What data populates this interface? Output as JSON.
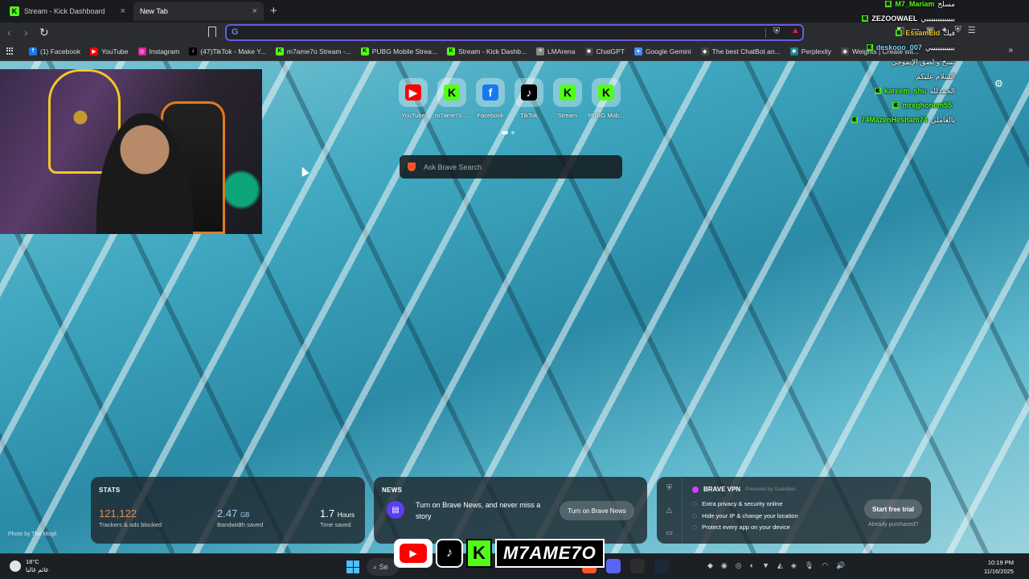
{
  "tabs": [
    {
      "label": "Stream - Kick Dashboard",
      "favicon": "K"
    },
    {
      "label": "New Tab"
    }
  ],
  "bookmarks": [
    {
      "label": "(1) Facebook",
      "icon": "facebook-icon",
      "color": "#1877f2",
      "glyph": "f"
    },
    {
      "label": "YouTube",
      "icon": "youtube-icon",
      "color": "#ff0000",
      "glyph": "▶"
    },
    {
      "label": "Instagram",
      "icon": "instagram-icon",
      "color": "#d6249f",
      "glyph": "◎"
    },
    {
      "label": "(47)TikTok - Make Y...",
      "icon": "tiktok-icon",
      "color": "#000000",
      "glyph": "♪"
    },
    {
      "label": "m7ame7o Stream -...",
      "icon": "kick-icon",
      "color": "#53fc18",
      "glyph": "K"
    },
    {
      "label": "PUBG Mobile Strea...",
      "icon": "kick-icon",
      "color": "#53fc18",
      "glyph": "K"
    },
    {
      "label": "Stream - Kick Dashb...",
      "icon": "kick-icon",
      "color": "#53fc18",
      "glyph": "K"
    },
    {
      "label": "LMArena",
      "icon": "lmarena-icon",
      "color": "#888888",
      "glyph": "≡"
    },
    {
      "label": "ChatGPT",
      "icon": "chatgpt-icon",
      "color": "#444444",
      "glyph": "✺"
    },
    {
      "label": "Google Gemini",
      "icon": "gemini-icon",
      "color": "#4a8af4",
      "glyph": "✦"
    },
    {
      "label": "The best ChatBot an...",
      "icon": "chatbot-icon",
      "color": "#444444",
      "glyph": "◆"
    },
    {
      "label": "Perplexity",
      "icon": "perplexity-icon",
      "color": "#20808d",
      "glyph": "✱"
    },
    {
      "label": "Weights | Create wit...",
      "icon": "weights-icon",
      "color": "#444444",
      "glyph": "◉"
    }
  ],
  "shortcuts": [
    {
      "label": "YouTube",
      "icon": "youtube-icon",
      "color": "#ff0000",
      "glyph": "▶"
    },
    {
      "label": "m7ame7o ...",
      "icon": "kick-icon",
      "color": "#53fc18",
      "glyph": "K"
    },
    {
      "label": "Facebook",
      "icon": "facebook-icon",
      "color": "#1877f2",
      "glyph": "f"
    },
    {
      "label": "TikTok",
      "icon": "tiktok-icon",
      "color": "#000000",
      "glyph": "♪"
    },
    {
      "label": "Stream",
      "icon": "kick-icon",
      "color": "#53fc18",
      "glyph": "K"
    },
    {
      "label": "PUBG Mob...",
      "icon": "kick-icon",
      "color": "#53fc18",
      "glyph": "K"
    }
  ],
  "search": {
    "placeholder": "Ask Brave Search"
  },
  "chat": [
    {
      "user": "M7_Mariam",
      "color": "#53fc18",
      "msg": "مسلح"
    },
    {
      "user": "ZEZOOWAEL",
      "color": "#ffffff",
      "msg": "يييييييييييييي"
    },
    {
      "user": "EssamEid",
      "color": "#f3c72a",
      "msg": "فيك"
    },
    {
      "user": "deskooo_007",
      "color": "#7ad7ff",
      "msg": "يييييييييييي"
    },
    {
      "user": "",
      "color": "#ffffff",
      "msg": "نسخ و لصق الإيموجي"
    },
    {
      "user": "",
      "color": "#ffffff",
      "msg": "السلام عليكم"
    },
    {
      "user": "kareem_shu",
      "color": "#53fc18",
      "msg": "الحمدلله"
    },
    {
      "user": "mrxghonem55",
      "color": "#53fc18",
      "msg": ""
    },
    {
      "user": "74MazenHesham74",
      "color": "#53fc18",
      "msg": "يالغاملي"
    }
  ],
  "stats": {
    "title": "STATS",
    "trackers_value": "121,122",
    "trackers_label": "Trackers & ads blocked",
    "bandwidth_value": "2.47",
    "bandwidth_unit": "GB",
    "bandwidth_label": "Bandwidth saved",
    "time_value": "1.7",
    "time_unit": "Hours",
    "time_label": "Time saved"
  },
  "news": {
    "title": "NEWS",
    "text": "Turn on Brave News, and never miss a story",
    "button": "Turn on Brave News"
  },
  "vpn": {
    "title": "BRAVE VPN",
    "powered": "Powered by Guardian",
    "features": [
      "Extra privacy & security online",
      "Hide your IP & change your location",
      "Protect every app on your device"
    ],
    "button": "Start free trial",
    "link": "Already purchased?"
  },
  "wallpaper_credit": "Photo by The Mogli",
  "taskbar": {
    "weather_temp": "18°C",
    "weather_desc": "غائم غالبا",
    "search_label": "Se",
    "time": "10:19 PM",
    "date": "11/16/2025"
  },
  "brand": {
    "name": "M7AME7O"
  }
}
